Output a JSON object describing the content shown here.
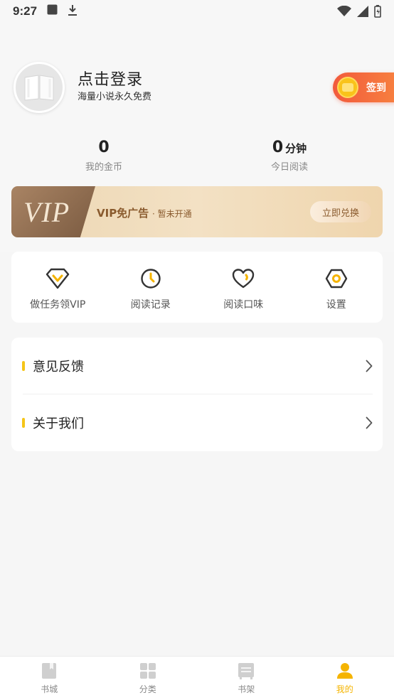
{
  "status_bar": {
    "time": "9:27"
  },
  "profile": {
    "title": "点击登录",
    "subtitle": "海量小说永久免费",
    "checkin_label": "签到"
  },
  "stats": [
    {
      "value": "0",
      "unit": "",
      "label": "我的金币"
    },
    {
      "value": "0",
      "unit": "分钟",
      "label": "今日阅读"
    }
  ],
  "vip_banner": {
    "logo": "VIP",
    "title": "VIP免广告",
    "status": "· 暂未开通",
    "button": "立即兑换"
  },
  "actions": [
    {
      "label": "做任务领VIP",
      "icon": "diamond-icon"
    },
    {
      "label": "阅读记录",
      "icon": "clock-icon"
    },
    {
      "label": "阅读口味",
      "icon": "heart-icon"
    },
    {
      "label": "设置",
      "icon": "settings-hexagon-icon"
    }
  ],
  "menu": [
    {
      "label": "意见反馈"
    },
    {
      "label": "关于我们"
    }
  ],
  "bottom_nav": [
    {
      "label": "书城",
      "icon": "book-icon",
      "active": false
    },
    {
      "label": "分类",
      "icon": "grid-icon",
      "active": false
    },
    {
      "label": "书架",
      "icon": "bookshelf-icon",
      "active": false
    },
    {
      "label": "我的",
      "icon": "user-icon",
      "active": true
    }
  ],
  "colors": {
    "accent": "#f5b400",
    "checkin": "#f25a3c",
    "vip_text": "#8a5b2e",
    "menu_bar": "#f5c518"
  }
}
